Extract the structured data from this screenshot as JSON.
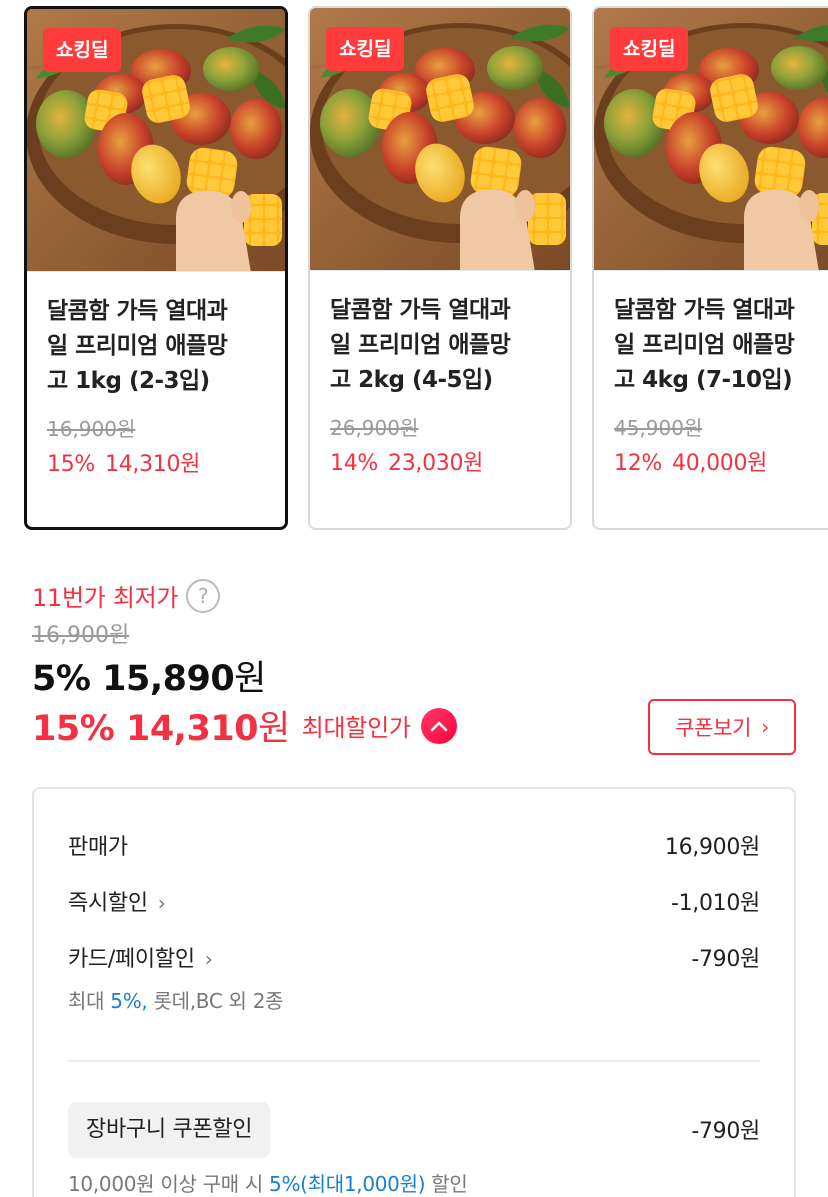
{
  "carousel": {
    "items": [
      {
        "badge": "쇼킹딜",
        "name": "달콤함 가득 열대과\n일 프리미엄 애플망\n고 1kg (2-3입)",
        "original_price": "16,900원",
        "discount_rate": "15%",
        "sale_price": "14,310원",
        "selected": true
      },
      {
        "badge": "쇼킹딜",
        "name": "달콤함 가득 열대과\n일 프리미엄 애플망\n고 2kg (4-5입)",
        "original_price": "26,900원",
        "discount_rate": "14%",
        "sale_price": "23,030원",
        "selected": false
      },
      {
        "badge": "쇼킹딜",
        "name": "달콤함 가득 열대과\n일 프리미엄 애플망\n고 4kg (7-10입)",
        "original_price": "45,900원",
        "discount_rate": "12%",
        "sale_price": "40,000원",
        "selected": false
      }
    ]
  },
  "price": {
    "lowest_label": "11번가 최저가",
    "help_glyph": "?",
    "original": "16,900원",
    "main_value": "5% 15,890",
    "main_unit": "원",
    "max_value": "15% 14,310",
    "max_unit": "원",
    "max_label": "최대할인가",
    "coupon_button": "쿠폰보기",
    "coupon_chevron": "›"
  },
  "breakdown": {
    "rows": [
      {
        "label": "판매가",
        "amount": "16,900원"
      },
      {
        "label": "즉시할인",
        "chevron": "›",
        "amount": "-1,010원"
      },
      {
        "label": "카드/페이할인",
        "chevron": "›",
        "amount": "-790원"
      }
    ],
    "card_note_prefix": "최대 ",
    "card_note_highlight": "5%,",
    "card_note_suffix": " 롯데,BC 외 2종",
    "cart_coupon_label": "장바구니 쿠폰할인",
    "cart_coupon_amount": "-790원",
    "cart_note_prefix": "10,000원 이상 구매 시 ",
    "cart_note_highlight": "5%(최대1,000원)",
    "cart_note_suffix": " 할인"
  },
  "colors": {
    "accent": "#f43142",
    "badge": "#ff3b3b",
    "link_blue": "#1a7fd4"
  },
  "icons": {
    "help": "question-circle-icon",
    "up": "chevron-up-circle-icon",
    "chevron": "chevron-right-icon"
  }
}
